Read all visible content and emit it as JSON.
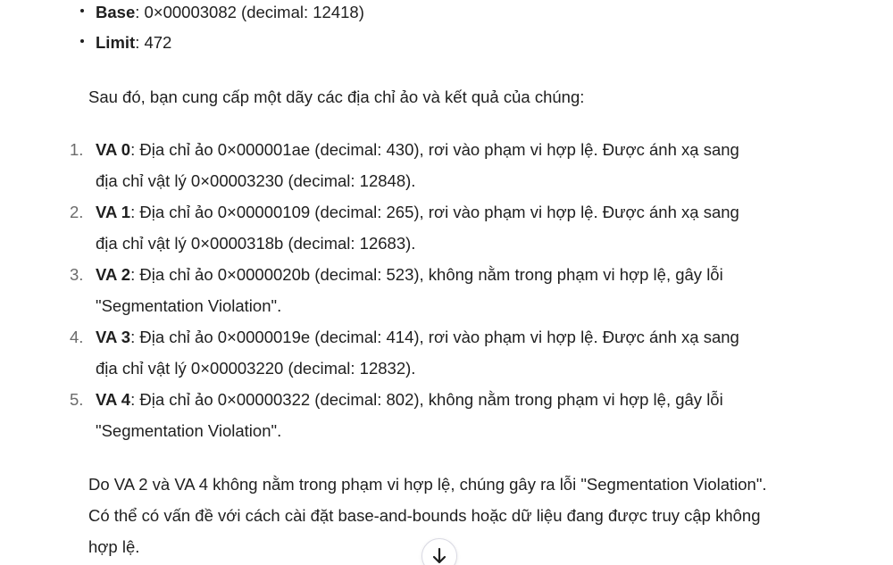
{
  "summary_bullets": [
    {
      "label": "Base",
      "text": ": 0×00003082 (decimal: 12418)"
    },
    {
      "label": "Limit",
      "text": ": 472"
    }
  ],
  "intro_text": "Sau đó, bạn cung cấp một dãy các địa chỉ ảo và kết quả của chúng:",
  "results": [
    {
      "number": "1.",
      "label": "VA 0",
      "line1": ": Địa chỉ ảo 0×000001ae (decimal: 430), rơi vào phạm vi hợp lệ. Được ánh xạ sang",
      "line2": "địa chỉ vật lý 0×00003230 (decimal: 12848)."
    },
    {
      "number": "2.",
      "label": "VA 1",
      "line1": ": Địa chỉ ảo 0×00000109 (decimal: 265), rơi vào phạm vi hợp lệ. Được ánh xạ sang",
      "line2": "địa chỉ vật lý 0×0000318b (decimal: 12683)."
    },
    {
      "number": "3.",
      "label": "VA 2",
      "line1": ": Địa chỉ ảo 0×0000020b (decimal: 523), không nằm trong phạm vi hợp lệ, gây lỗi",
      "line2": "\"Segmentation Violation\"."
    },
    {
      "number": "4.",
      "label": "VA 3",
      "line1": ": Địa chỉ ảo 0×0000019e (decimal: 414), rơi vào phạm vi hợp lệ. Được ánh xạ sang",
      "line2": "địa chỉ vật lý 0×00003220 (decimal: 12832)."
    },
    {
      "number": "5.",
      "label": "VA 4",
      "line1": ": Địa chỉ ảo 0×00000322 (decimal: 802), không nằm trong phạm vi hợp lệ, gây lỗi",
      "line2": "\"Segmentation Violation\"."
    }
  ],
  "conclusion_text": "Do VA 2 và VA 4 không nằm trong phạm vi hợp lệ, chúng gây ra lỗi \"Segmentation Violation\". Có thể có vấn đề với cách cài đặt base-and-bounds hoặc dữ liệu đang được truy cập không hợp lệ.",
  "scroll_button": {
    "icon": "arrow-down-icon"
  }
}
